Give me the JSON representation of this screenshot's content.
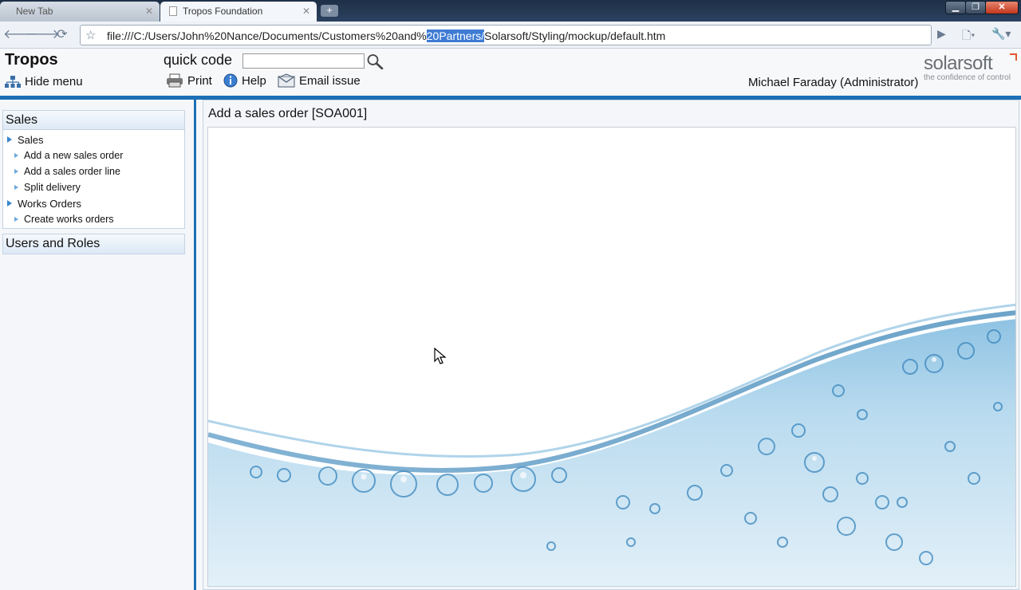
{
  "browser": {
    "tabs": [
      {
        "label": "New Tab",
        "active": false
      },
      {
        "label": "Tropos Foundation",
        "active": true
      }
    ],
    "url_before": "file:///C:/Users/John%20Nance/Documents/Customers%20and%",
    "url_selected": "20Partners/",
    "url_after": "Solarsoft/Styling/mockup/default.htm"
  },
  "header": {
    "brand": "Tropos",
    "quick_code_label": "quick code",
    "quick_code_value": "",
    "hide_menu_label": "Hide menu",
    "print_label": "Print",
    "help_label": "Help",
    "email_label": "Email issue",
    "user": "Michael Faraday (Administrator)",
    "logo_word": "solarsoft",
    "logo_tagline": "the confidence of control"
  },
  "sidebar": {
    "panels": [
      {
        "title": "Sales",
        "items": [
          {
            "label": "Sales",
            "level": 1
          },
          {
            "label": "Add a new sales order",
            "level": 2
          },
          {
            "label": "Add a sales order line",
            "level": 2
          },
          {
            "label": "Split delivery",
            "level": 2
          },
          {
            "label": "Works Orders",
            "level": 1
          },
          {
            "label": "Create works orders",
            "level": 2
          }
        ]
      },
      {
        "title": "Users and Roles",
        "items": []
      }
    ]
  },
  "content": {
    "title": "Add a sales order [SOA001]"
  },
  "colors": {
    "accent": "#1d6fb6",
    "water": "#5fa3cc",
    "logo_corner": "#e4572e"
  }
}
